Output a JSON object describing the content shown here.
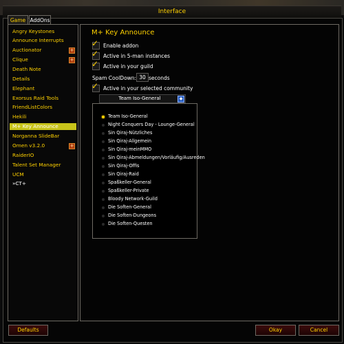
{
  "window": {
    "title": "Interface"
  },
  "tabs": [
    {
      "label": "Game"
    },
    {
      "label": "AddOns"
    }
  ],
  "sidebar": {
    "items": [
      {
        "label": "Angry Keystones"
      },
      {
        "label": "Announce Interrupts"
      },
      {
        "label": "Auctionator"
      },
      {
        "label": "Clique"
      },
      {
        "label": "Death Note"
      },
      {
        "label": "Details"
      },
      {
        "label": "Elephant"
      },
      {
        "label": "Exorsus Raid Tools"
      },
      {
        "label": "FriendListColors"
      },
      {
        "label": "Hekili"
      },
      {
        "label": "M+ Key Announce"
      },
      {
        "label": "Norganna SlideBar"
      },
      {
        "label": "Omen v3.2.0"
      },
      {
        "label": "RaiderIO"
      },
      {
        "label": "Talent Set Manager"
      },
      {
        "label": "UCM"
      },
      {
        "label": "»CT+"
      }
    ],
    "selected": "M+ Key Announce"
  },
  "panel": {
    "title": "M+ Key Announce",
    "options": [
      {
        "label": "Enable addon",
        "checked": true
      },
      {
        "label": "Active in 5-man instances",
        "checked": true
      },
      {
        "label": "Active in your guild",
        "checked": true
      },
      {
        "label": "Active in your selected community",
        "checked": true
      }
    ],
    "cooldown": {
      "label": "Spam CoolDown:",
      "value": "30",
      "unit": "seconds"
    },
    "community_dropdown": {
      "selected": "Team Iso-General"
    },
    "community_menu": [
      "Team Iso-General",
      "Night Conquers Day - Lounge-General",
      "Sin Qiraj-Nützliches",
      "Sin Qiraj-Allgemein",
      "Sin Qiraj-meinMMO",
      "Sin Qiraj-Abmeldungen/Vorläufig/Ausreden",
      "Sin Qiraj-Offis",
      "Sin Qiraj-Raid",
      "Spaßkeller-General",
      "Spaßkeller-Private",
      "Bloody Network-Guild",
      "Die Soften-General",
      "Die Soften-Dungeons",
      "Die Soften-Questen"
    ]
  },
  "buttons": {
    "defaults": "Defaults",
    "okay": "Okay",
    "cancel": "Cancel"
  },
  "colors": {
    "accent": "#ffd100",
    "selection": "#c8c41a",
    "button_bg": "#3b0c0c"
  }
}
